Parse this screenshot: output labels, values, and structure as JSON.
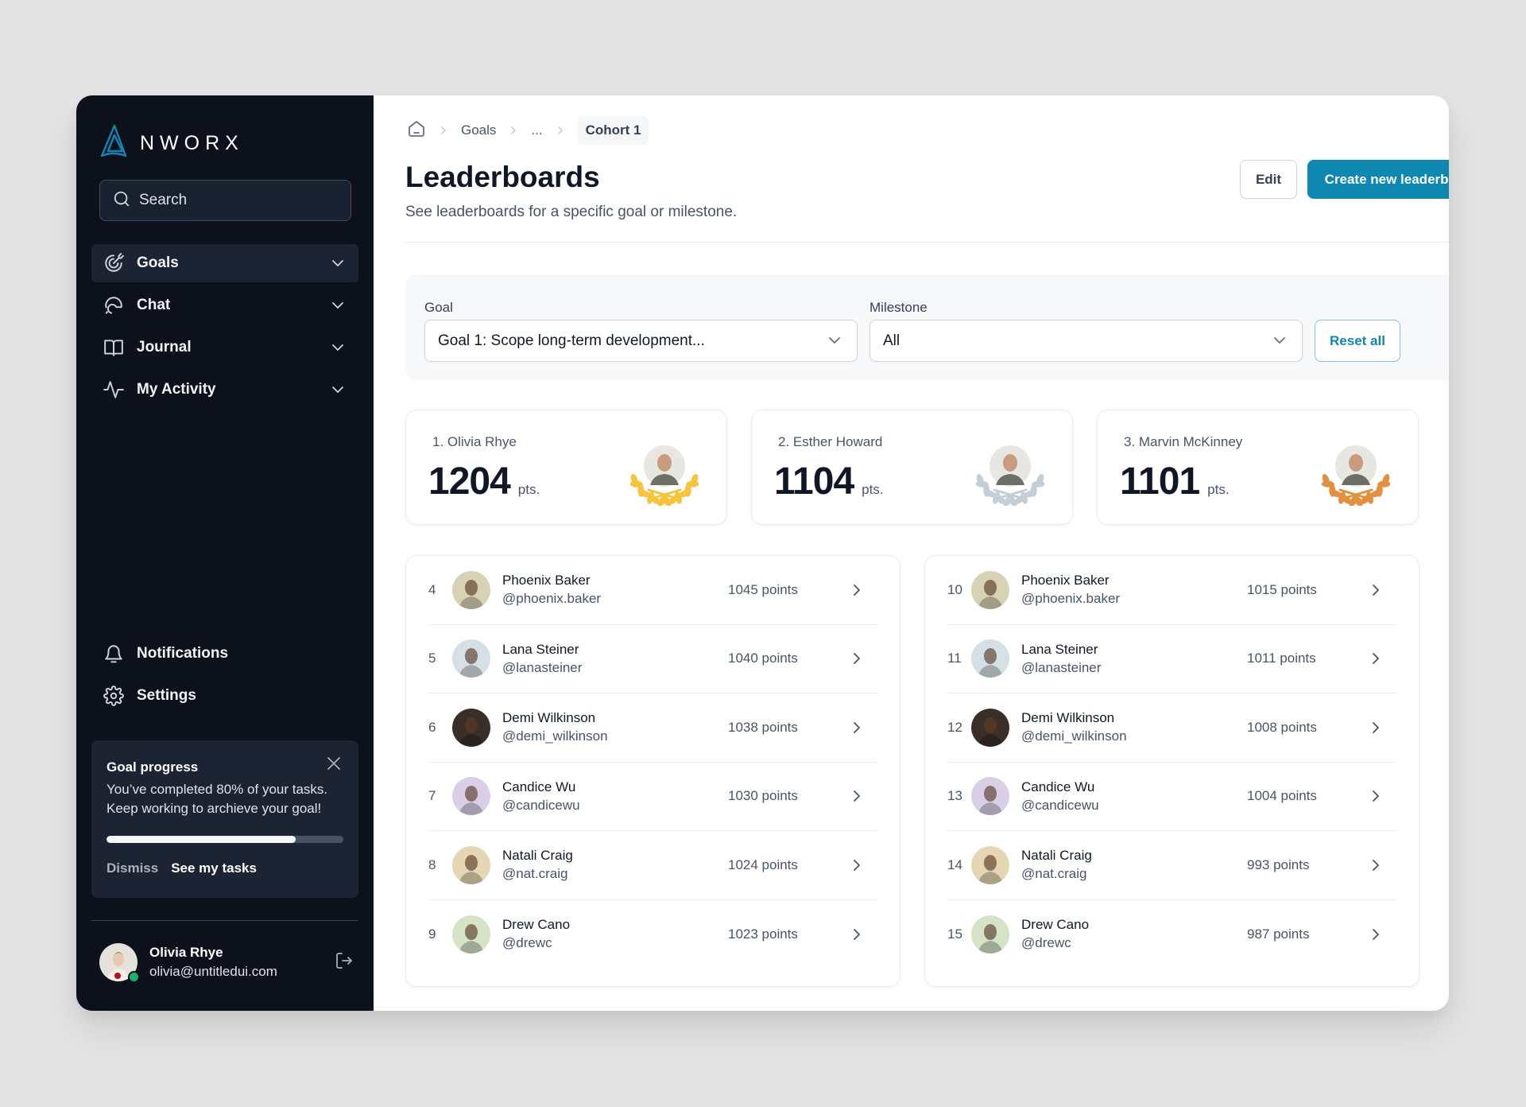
{
  "app": {
    "brand": "NWORX",
    "brand_color": "#0e87b1"
  },
  "sidebar": {
    "search_placeholder": "Search",
    "nav": [
      {
        "label": "Goals",
        "icon": "target-icon",
        "active": true
      },
      {
        "label": "Chat",
        "icon": "chat-icon",
        "active": false
      },
      {
        "label": "Journal",
        "icon": "book-icon",
        "active": false
      },
      {
        "label": "My Activity",
        "icon": "activity-icon",
        "active": false
      }
    ],
    "bottom_nav": [
      {
        "label": "Notifications",
        "icon": "bell-icon"
      },
      {
        "label": "Settings",
        "icon": "gear-icon"
      }
    ],
    "progress_card": {
      "title": "Goal progress",
      "text": "You’ve completed 80% of your tasks. Keep working to archieve your goal!",
      "progress_percent": 80,
      "dismiss_label": "Dismiss",
      "see_tasks_label": "See my tasks"
    },
    "user": {
      "name": "Olivia Rhye",
      "email": "olivia@untitledui.com",
      "status": "online"
    }
  },
  "breadcrumb": {
    "items": [
      "Goals",
      "..."
    ],
    "current": "Cohort 1"
  },
  "header": {
    "title": "Leaderboards",
    "subtitle": "See leaderboards for a specific goal or milestone.",
    "edit_label": "Edit",
    "create_label": "Create new leaderboard"
  },
  "filters": {
    "goal_label": "Goal",
    "goal_value": "Goal 1: Scope long-term development...",
    "milestone_label": "Milestone",
    "milestone_value": "All",
    "reset_label": "Reset all"
  },
  "podium": [
    {
      "name": "1. Olivia Rhye",
      "points": "1204",
      "unit": "pts.",
      "medal": "gold",
      "medal_color": "#f6c33d"
    },
    {
      "name": "2. Esther Howard",
      "points": "1104",
      "unit": "pts.",
      "medal": "silver",
      "medal_color": "#c3ced6"
    },
    {
      "name": "3. Marvin McKinney",
      "points": "1101",
      "unit": "pts.",
      "medal": "bronze",
      "medal_color": "#e0903f"
    }
  ],
  "lists": [
    [
      {
        "rank": "4",
        "name": "Phoenix Baker",
        "handle": "@phoenix.baker",
        "points": "1045 points",
        "avatar_bg": "#d8d2b4"
      },
      {
        "rank": "5",
        "name": "Lana Steiner",
        "handle": "@lanasteiner",
        "points": "1040 points",
        "avatar_bg": "#d5e0e6"
      },
      {
        "rank": "6",
        "name": "Demi Wilkinson",
        "handle": "@demi_wilkinson",
        "points": "1038 points",
        "avatar_bg": "#3a2e28"
      },
      {
        "rank": "7",
        "name": "Candice Wu",
        "handle": "@candicewu",
        "points": "1030 points",
        "avatar_bg": "#d9d0e8"
      },
      {
        "rank": "8",
        "name": "Natali Craig",
        "handle": "@nat.craig",
        "points": "1024 points",
        "avatar_bg": "#e6d7b4"
      },
      {
        "rank": "9",
        "name": "Drew Cano",
        "handle": "@drewc",
        "points": "1023 points",
        "avatar_bg": "#d5e3c7"
      }
    ],
    [
      {
        "rank": "10",
        "name": "Phoenix Baker",
        "handle": "@phoenix.baker",
        "points": "1015 points",
        "avatar_bg": "#d8d2b4"
      },
      {
        "rank": "11",
        "name": "Lana Steiner",
        "handle": "@lanasteiner",
        "points": "1011 points",
        "avatar_bg": "#d5e0e6"
      },
      {
        "rank": "12",
        "name": "Demi Wilkinson",
        "handle": "@demi_wilkinson",
        "points": "1008 points",
        "avatar_bg": "#3a2e28"
      },
      {
        "rank": "13",
        "name": "Candice Wu",
        "handle": "@candicewu",
        "points": "1004 points",
        "avatar_bg": "#d9d0e8"
      },
      {
        "rank": "14",
        "name": "Natali Craig",
        "handle": "@nat.craig",
        "points": "993 points",
        "avatar_bg": "#e6d7b4"
      },
      {
        "rank": "15",
        "name": "Drew Cano",
        "handle": "@drewc",
        "points": "987 points",
        "avatar_bg": "#d5e3c7"
      }
    ]
  ]
}
